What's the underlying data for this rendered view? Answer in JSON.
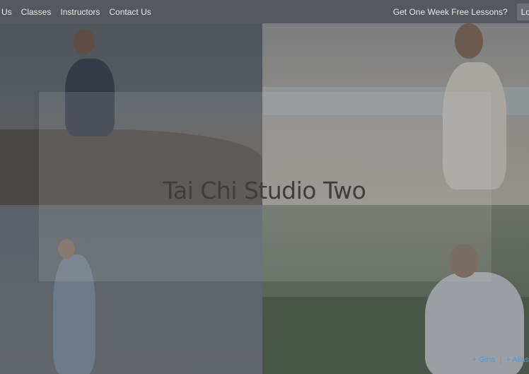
{
  "nav": {
    "left_items": [
      "Us",
      "Classes",
      "Instructors",
      "Contact Us"
    ],
    "promo": "Get One Week Free Lessons?",
    "login": "Lo"
  },
  "hero": {
    "title": "Tai Chi Studio Two"
  },
  "credits": {
    "link1": "+ Gina",
    "separator": "|",
    "link2": "+ Alias"
  },
  "colors": {
    "overlay": "#55585e",
    "link": "#4f9ad6",
    "title": "#3e3e3e"
  }
}
